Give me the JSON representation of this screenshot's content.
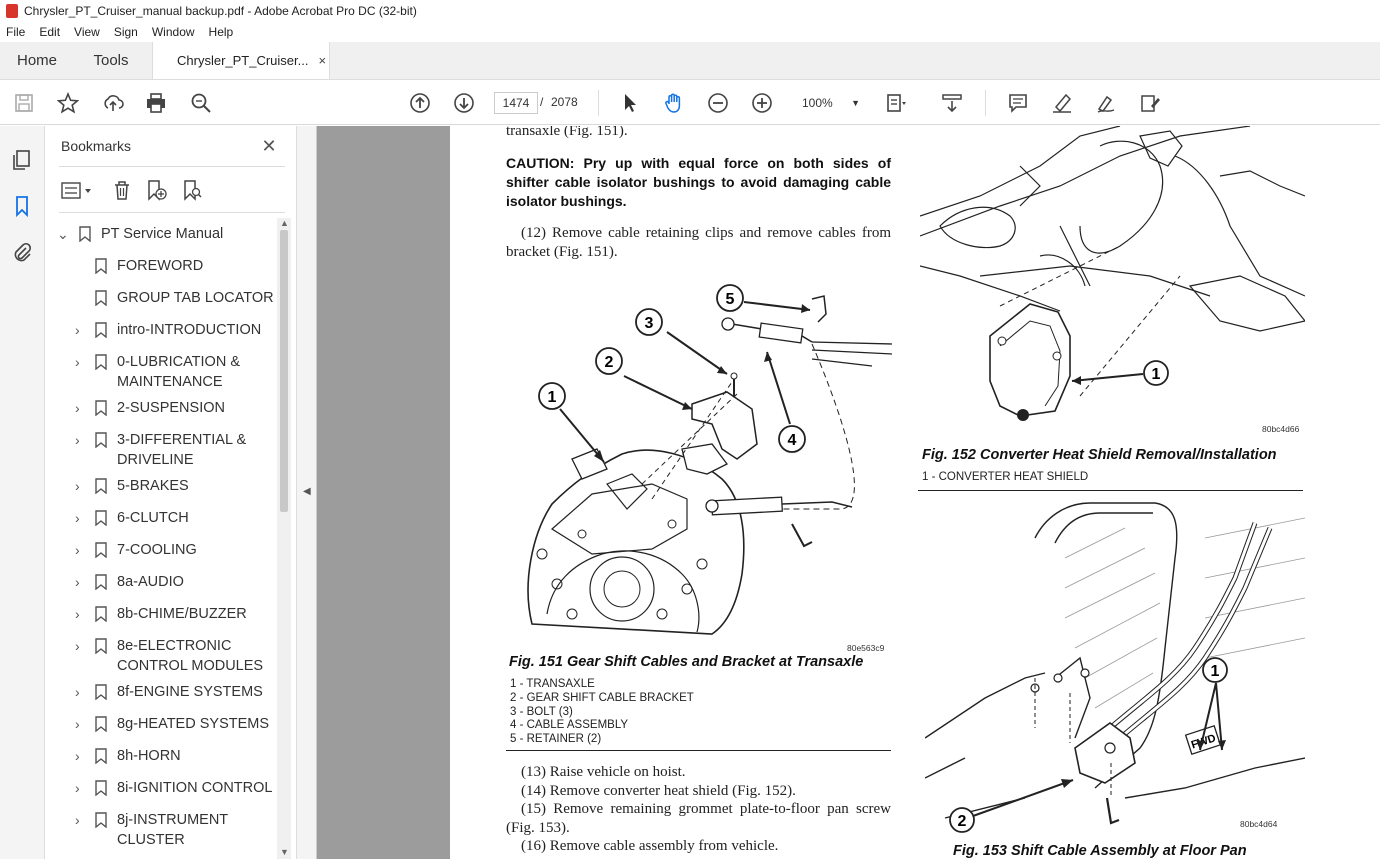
{
  "window": {
    "title": "Chrysler_PT_Cruiser_manual backup.pdf - Adobe Acrobat Pro DC (32-bit)"
  },
  "menu": [
    "File",
    "Edit",
    "View",
    "Sign",
    "Window",
    "Help"
  ],
  "tabs": {
    "home": "Home",
    "tools": "Tools",
    "document": "Chrysler_PT_Cruiser...",
    "close": "×"
  },
  "toolbar": {
    "page_current": "1474",
    "page_separator": "/",
    "page_total": "2078",
    "zoom": "100%",
    "icons": [
      "save-icon",
      "star-icon",
      "upload-icon",
      "print-icon",
      "search-zoom-icon",
      "arrow-up-icon",
      "arrow-down-icon",
      "pointer-icon",
      "hand-icon",
      "zoom-out-icon",
      "zoom-in-icon",
      "fit-page-icon",
      "scroll-mode-icon",
      "comment-icon",
      "highlight-icon",
      "sign-icon",
      "fill-sign-icon"
    ]
  },
  "leftrail": {
    "icons": [
      "pages-icon",
      "bookmark-icon",
      "attachment-icon"
    ]
  },
  "bookmarks": {
    "title": "Bookmarks",
    "close": "✕",
    "items": [
      {
        "label": "PT Service Manual",
        "expanded": true,
        "level": 0
      },
      {
        "label": "FOREWORD",
        "level": 1,
        "leaf": true
      },
      {
        "label": "GROUP TAB LOCATOR",
        "level": 1,
        "leaf": true
      },
      {
        "label": "intro-INTRODUCTION",
        "level": 1
      },
      {
        "label": "0-LUBRICATION & MAINTENANCE",
        "level": 1
      },
      {
        "label": "2-SUSPENSION",
        "level": 1
      },
      {
        "label": "3-DIFFERENTIAL & DRIVELINE",
        "level": 1
      },
      {
        "label": "5-BRAKES",
        "level": 1
      },
      {
        "label": "6-CLUTCH",
        "level": 1
      },
      {
        "label": "7-COOLING",
        "level": 1
      },
      {
        "label": "8a-AUDIO",
        "level": 1
      },
      {
        "label": "8b-CHIME/BUZZER",
        "level": 1
      },
      {
        "label": "8e-ELECTRONIC CONTROL MODULES",
        "level": 1
      },
      {
        "label": "8f-ENGINE SYSTEMS",
        "level": 1
      },
      {
        "label": "8g-HEATED SYSTEMS",
        "level": 1
      },
      {
        "label": "8h-HORN",
        "level": 1
      },
      {
        "label": "8i-IGNITION CONTROL",
        "level": 1
      },
      {
        "label": "8j-INSTRUMENT CLUSTER",
        "level": 1
      }
    ]
  },
  "doc": {
    "top_text": "transaxle (Fig. 151).",
    "caution": "CAUTION: Pry up with equal force on both sides of shifter cable isolator bushings to avoid damaging cable isolator bushings.",
    "step12": "(12) Remove cable retaining clips and remove cables from bracket (Fig. 151).",
    "fig151": {
      "code": "80e563c9",
      "caption": "Fig. 151 Gear Shift Cables and Bracket at Transaxle",
      "callouts": [
        "1",
        "2",
        "3",
        "4",
        "5"
      ],
      "legend": [
        "1 - TRANSAXLE",
        "2 - GEAR SHIFT CABLE BRACKET",
        "3 - BOLT (3)",
        "4 - CABLE ASSEMBLY",
        "5 - RETAINER (2)"
      ]
    },
    "steps_after": [
      "(13) Raise vehicle on hoist.",
      "(14) Remove converter heat shield (Fig. 152).",
      "(15) Remove remaining grommet plate-to-floor pan screw (Fig. 153).",
      "(16) Remove cable assembly from vehicle."
    ],
    "fig152": {
      "code": "80bc4d66",
      "caption": "Fig. 152 Converter Heat Shield Removal/Installation",
      "callouts": [
        "1"
      ],
      "legend": [
        "1 - CONVERTER HEAT SHIELD"
      ]
    },
    "fig153": {
      "code": "80bc4d64",
      "caption": "Fig. 153 Shift Cable Assembly at Floor Pan",
      "callouts": [
        "1",
        "2"
      ],
      "stamp": "FWD"
    }
  }
}
